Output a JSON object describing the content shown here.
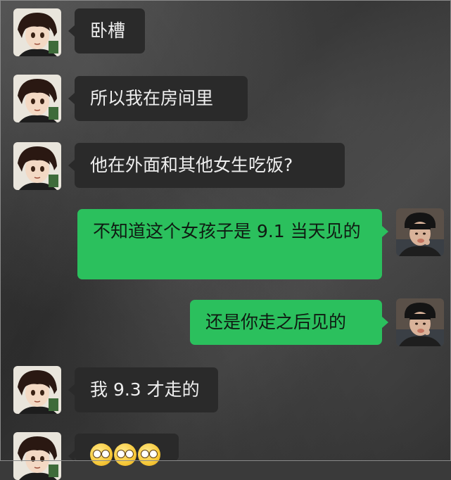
{
  "messages": [
    {
      "side": "left",
      "sender": "contact",
      "text": "卧槽"
    },
    {
      "side": "left",
      "sender": "contact",
      "text": "所以我在房间里"
    },
    {
      "side": "left",
      "sender": "contact",
      "text": "他在外面和其他女生吃饭?"
    },
    {
      "side": "right",
      "sender": "me",
      "text": "不知道这个女孩子是 9.1 当天见的"
    },
    {
      "side": "right",
      "sender": "me",
      "text": "还是你走之后见的"
    },
    {
      "side": "left",
      "sender": "contact",
      "text": "我 9.3 才走的"
    },
    {
      "side": "left",
      "sender": "contact",
      "emoji": [
        "flushed-face-icon",
        "flushed-face-icon",
        "flushed-face-icon"
      ]
    }
  ],
  "colors": {
    "my_bubble": "#2bc05d",
    "contact_bubble": "#2a2a2a",
    "contact_text": "#eeeeee"
  }
}
